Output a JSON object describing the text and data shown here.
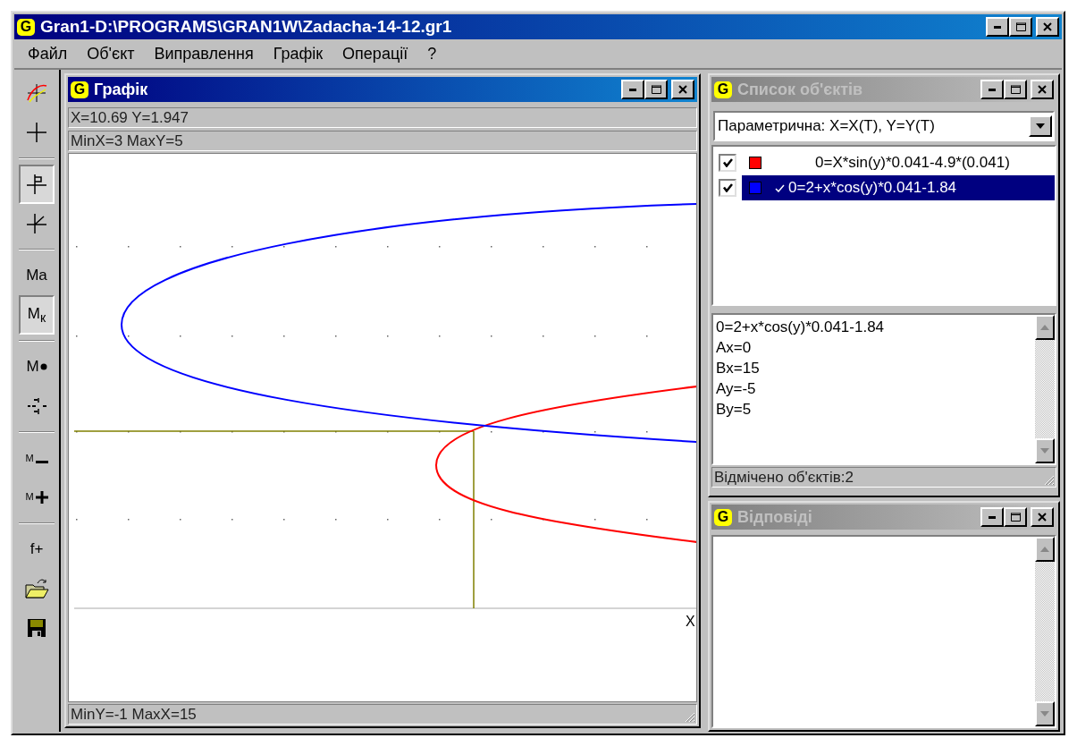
{
  "window": {
    "logo": "G",
    "title": "Gran1-D:\\PROGRAMS\\GRAN1W\\Zadacha-14-12.gr1"
  },
  "menu": [
    "Файл",
    "Об'єкт",
    "Виправлення",
    "Графік",
    "Операції",
    "?"
  ],
  "toolbar": [
    [
      {
        "kind": "graph",
        "pressed": false
      },
      {
        "kind": "cross",
        "pressed": false
      }
    ],
    [
      {
        "kind": "cross-flag",
        "pressed": true
      },
      {
        "kind": "cross-slash",
        "pressed": false
      }
    ],
    [
      {
        "kind": "text",
        "label": "Ma",
        "pressed": false
      },
      {
        "kind": "text",
        "label": "M$_{к}$",
        "pressed": true
      }
    ],
    [
      {
        "kind": "m-dot",
        "label": "M",
        "pressed": false
      },
      {
        "kind": "scale",
        "pressed": false
      }
    ],
    [
      {
        "kind": "m-minus",
        "label": "M",
        "pressed": false
      },
      {
        "kind": "m-plus",
        "label": "M",
        "pressed": false
      }
    ],
    [
      {
        "kind": "text",
        "label": "f+",
        "pressed": false
      },
      {
        "kind": "open",
        "pressed": false
      },
      {
        "kind": "save",
        "pressed": false
      }
    ]
  ],
  "graph": {
    "logo": "G",
    "title": "Графік",
    "active": true,
    "coords": "X=10.69  Y=1.947",
    "range_top": "MinX=3  MaxY=5",
    "range_bottom": "MinY=-1  MaxX=15",
    "axis_label": "X"
  },
  "objects_window": {
    "logo": "G",
    "title": "Список об'єктів",
    "active": false,
    "mode": "Параметрична:  X=X(T), Y=Y(T)",
    "items": [
      {
        "checked": true,
        "color": "#ff0000",
        "formula": "0=X*sin(y)*0.041-4.9*(0.041)",
        "selected": false,
        "current": false
      },
      {
        "checked": true,
        "color": "#0000ff",
        "formula": "0=2+x*cos(y)*0.041-1.84",
        "selected": true,
        "current": true
      }
    ],
    "details": [
      "0=2+x*cos(y)*0.041-1.84",
      "Ax=0",
      "Bx=15",
      "Ay=-5",
      "By=5"
    ],
    "status": "Відмічено об'єктів:2"
  },
  "answers_window": {
    "logo": "G",
    "title": "Відповіді",
    "active": false
  }
}
